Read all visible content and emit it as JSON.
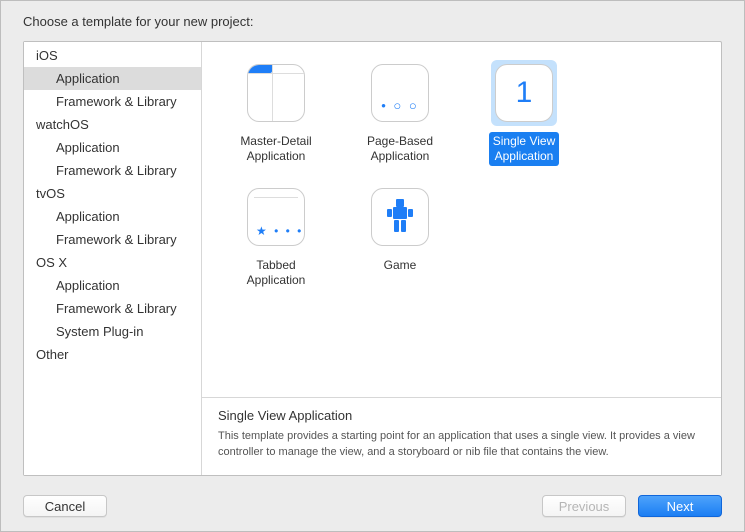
{
  "header": {
    "title": "Choose a template for your new project:"
  },
  "sidebar": {
    "groups": [
      {
        "label": "iOS",
        "items": [
          {
            "label": "Application",
            "selected": true
          },
          {
            "label": "Framework & Library"
          }
        ]
      },
      {
        "label": "watchOS",
        "items": [
          {
            "label": "Application"
          },
          {
            "label": "Framework & Library"
          }
        ]
      },
      {
        "label": "tvOS",
        "items": [
          {
            "label": "Application"
          },
          {
            "label": "Framework & Library"
          }
        ]
      },
      {
        "label": "OS X",
        "items": [
          {
            "label": "Application"
          },
          {
            "label": "Framework & Library"
          },
          {
            "label": "System Plug-in"
          }
        ]
      },
      {
        "label": "Other",
        "items": []
      }
    ]
  },
  "templates": [
    {
      "id": "master-detail",
      "label": "Master-Detail\nApplication",
      "icon": "master-detail-icon"
    },
    {
      "id": "page-based",
      "label": "Page-Based\nApplication",
      "icon": "page-based-icon"
    },
    {
      "id": "single-view",
      "label": "Single View\nApplication",
      "icon": "single-view-icon",
      "selected": true
    },
    {
      "id": "tabbed",
      "label": "Tabbed\nApplication",
      "icon": "tabbed-icon"
    },
    {
      "id": "game",
      "label": "Game",
      "icon": "game-icon"
    }
  ],
  "description": {
    "title": "Single View Application",
    "text": "This template provides a starting point for an application that uses a single view. It provides a view controller to manage the view, and a storyboard or nib file that contains the view."
  },
  "buttons": {
    "cancel": "Cancel",
    "previous": "Previous",
    "next": "Next"
  }
}
